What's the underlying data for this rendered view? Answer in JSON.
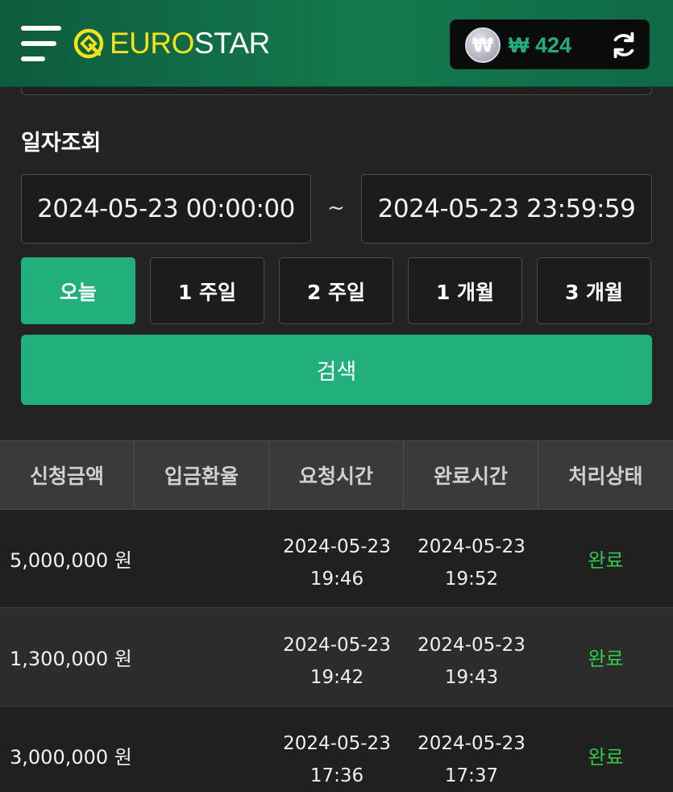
{
  "header": {
    "logo_part1": "EURO",
    "logo_part2": "STAR",
    "wallet": {
      "currency_symbol": "₩",
      "amount": "₩ 424"
    }
  },
  "filter": {
    "section_label": "일자조회",
    "start_date": "2024-05-23 00:00:00",
    "separator": "~",
    "end_date": "2024-05-23 23:59:59",
    "ranges": [
      {
        "label": "오늘",
        "active": true
      },
      {
        "label": "1 주일",
        "active": false
      },
      {
        "label": "2 주일",
        "active": false
      },
      {
        "label": "1 개월",
        "active": false
      },
      {
        "label": "3 개월",
        "active": false
      }
    ],
    "search_label": "검색"
  },
  "table": {
    "headers": [
      "신청금액",
      "입금환율",
      "요청시간",
      "완료시간",
      "처리상태"
    ],
    "rows": [
      {
        "amount": "5,000,000 원",
        "rate": "",
        "request_date": "2024-05-23",
        "request_time": "19:46",
        "complete_date": "2024-05-23",
        "complete_time": "19:52",
        "status": "완료"
      },
      {
        "amount": "1,300,000 원",
        "rate": "",
        "request_date": "2024-05-23",
        "request_time": "19:42",
        "complete_date": "2024-05-23",
        "complete_time": "19:43",
        "status": "완료"
      },
      {
        "amount": "3,000,000 원",
        "rate": "",
        "request_date": "2024-05-23",
        "request_time": "17:36",
        "complete_date": "2024-05-23",
        "complete_time": "17:37",
        "status": "완료"
      }
    ]
  },
  "colors": {
    "accent": "#21b07b",
    "header_bg": "#14794f",
    "logo_yellow": "#f5e21b",
    "status_complete": "#34c84a"
  },
  "icons": {
    "menu": "hamburger-icon",
    "logo": "eurostar-logo-icon",
    "coin": "won-coin-icon",
    "refresh": "refresh-icon"
  }
}
